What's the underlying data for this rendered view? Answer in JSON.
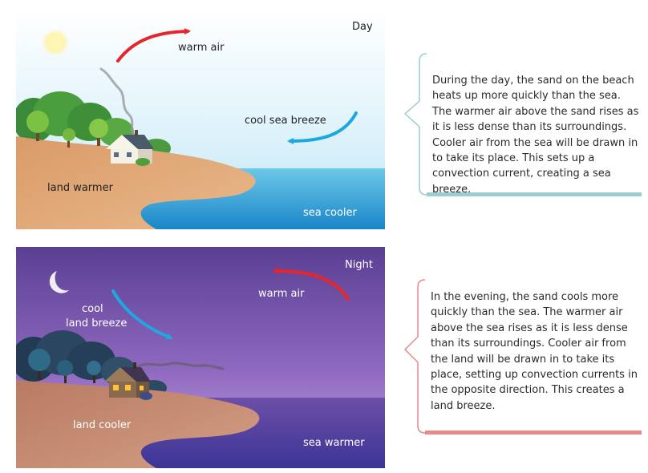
{
  "day_panel": {
    "title": "Day",
    "labels": {
      "warm_air": "warm air",
      "cool_sea_breeze": "cool sea breeze",
      "land": "land warmer",
      "sea": "sea cooler"
    },
    "description": "During the day, the sand on the beach heats up more quickly than the sea. The warmer air above the sand rises as it is less dense than its surroundings. Cooler air from the sea will be drawn in to take its place. This sets up a convection current, creating a sea breeze."
  },
  "night_panel": {
    "title": "Night",
    "labels": {
      "warm_air": "warm air",
      "cool_line1": "cool",
      "cool_line2": "land breeze",
      "land": "land cooler",
      "sea": "sea warmer"
    },
    "description": "In the evening, the sand cools more quickly than the sea. The warmer air above the sea rises as it is less dense than its surroundings. Cooler air from the land will be drawn in to take its place, setting up convection currents in the opposite direction. This creates a land breeze."
  },
  "colors": {
    "warm_arrow": "#e5262b",
    "cool_arrow": "#1fa8e0",
    "day_callout_border": "#9fcccf",
    "night_callout_border": "#e58a86"
  },
  "icons": [
    "sun-icon",
    "moon-icon",
    "house-icon",
    "tree-icon",
    "smoke-icon"
  ]
}
